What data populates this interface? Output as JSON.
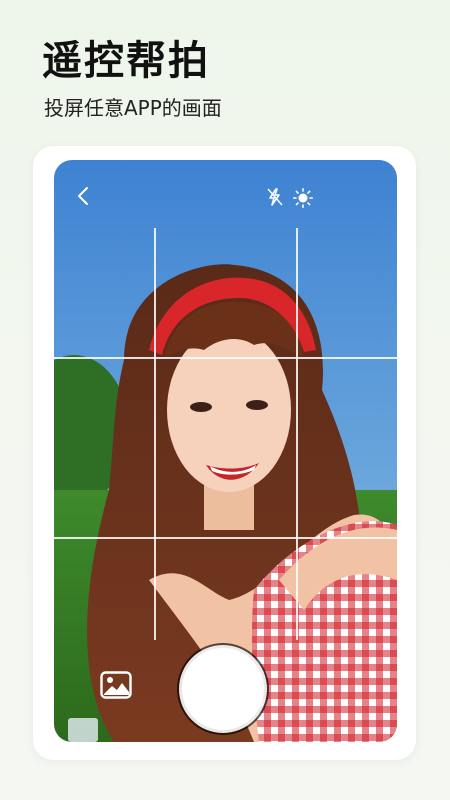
{
  "header": {
    "title": "遥控帮拍",
    "subtitle": "投屏任意APP的画面"
  },
  "camera": {
    "back_icon": "chevron-left-icon",
    "flash_icon": "flash-auto-icon",
    "brightness_icon": "sun-icon",
    "gallery_icon": "image-icon",
    "shutter_icon": "shutter-button"
  },
  "colors": {
    "accent": "#ffffff",
    "sky": "#4d8fd6",
    "headband": "#d8262a"
  }
}
